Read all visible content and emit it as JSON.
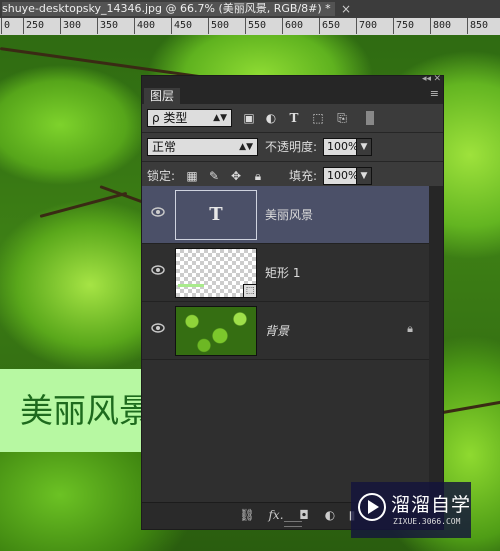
{
  "document": {
    "title": "shuye-desktopsky_14346.jpg @ 66.7% (美丽风景, RGB/8#) *",
    "close": "×"
  },
  "ruler": {
    "ticks": [
      "0",
      "250",
      "300",
      "350",
      "400",
      "450",
      "500",
      "550",
      "600",
      "650",
      "700",
      "750",
      "800",
      "850"
    ]
  },
  "canvas": {
    "banner_text": "美丽风景"
  },
  "panel": {
    "collapse": "◂◂",
    "close": "✕",
    "tab_label": "图层",
    "menu": "≡",
    "filter": {
      "selected": "ρ 类型",
      "icons": [
        "image-filter-icon",
        "adjustment-filter-icon",
        "type-filter-icon",
        "shape-filter-icon",
        "smartobject-filter-icon"
      ]
    },
    "blend_mode": "正常",
    "opacity_label": "不透明度:",
    "opacity_value": "100%",
    "lock_label": "锁定:",
    "fill_label": "填充:",
    "fill_value": "100%",
    "layers": [
      {
        "name": "美丽风景",
        "kind": "text",
        "thumb": "T",
        "selected": true
      },
      {
        "name": "矩形 1",
        "kind": "shape",
        "selected": false
      },
      {
        "name": "背景",
        "kind": "background",
        "selected": false,
        "locked": true
      }
    ],
    "bottom": {
      "link": "⛓",
      "fx": "fx.",
      "mask": "◘",
      "adjust": "◐",
      "more": "▮"
    }
  },
  "watermark": {
    "name": "溜溜自学",
    "url": "ZIXUE.3066.COM"
  },
  "colors": {
    "selected_layer": "#4b5068",
    "banner_bg": "#b7f8a2",
    "banner_text": "#1d6a1d"
  }
}
